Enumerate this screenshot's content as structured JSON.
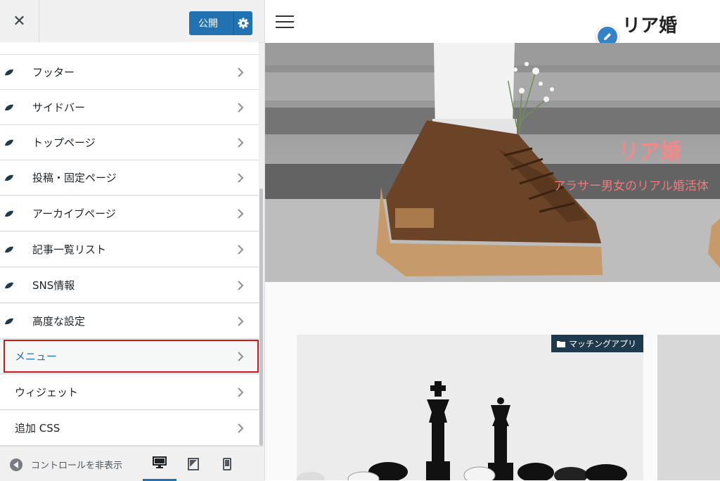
{
  "header": {
    "publish_label": "公開"
  },
  "menu_items": [
    {
      "label": "フッター",
      "icon": "leaf-icon"
    },
    {
      "label": "サイドバー",
      "icon": "leaf-icon"
    },
    {
      "label": "トップページ",
      "icon": "leaf-icon"
    },
    {
      "label": "投稿・固定ページ",
      "icon": "leaf-icon"
    },
    {
      "label": "アーカイブページ",
      "icon": "leaf-icon"
    },
    {
      "label": "記事一覧リスト",
      "icon": "leaf-icon"
    },
    {
      "label": "SNS情報",
      "icon": "leaf-icon"
    },
    {
      "label": "高度な設定",
      "icon": "leaf-icon"
    },
    {
      "label": "メニュー"
    },
    {
      "label": "ウィジェット"
    },
    {
      "label": "追加 CSS"
    }
  ],
  "footer": {
    "collapse_label": "コントロールを非表示"
  },
  "preview": {
    "site_title": "リア婚",
    "hero_title": "リア婚",
    "hero_subtitle": "アラサー男女のリアル婚活体",
    "card_category": "マッチングアプリ"
  },
  "colors": {
    "accent": "#2271b1",
    "highlight_border": "#d0151b",
    "hero_text": "#f08a8a"
  }
}
